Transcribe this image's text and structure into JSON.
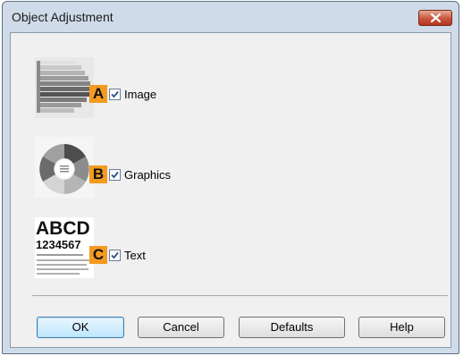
{
  "window": {
    "title": "Object Adjustment"
  },
  "options": [
    {
      "badge": "A",
      "label": "Image",
      "checked": true,
      "thumb_icon": "image-grayscale-bars-icon"
    },
    {
      "badge": "B",
      "label": "Graphics",
      "checked": true,
      "thumb_icon": "graphics-donut-icon"
    },
    {
      "badge": "C",
      "label": "Text",
      "checked": true,
      "thumb_icon": "text-sample-icon",
      "thumb_text": {
        "line1": "ABCD",
        "line2": "1234567"
      }
    }
  ],
  "buttons": {
    "ok": "OK",
    "cancel": "Cancel",
    "defaults": "Defaults",
    "help": "Help"
  },
  "colors": {
    "badge": "#f39a20",
    "dialog_frame": "#cfdbe8",
    "close": "#c9553b"
  }
}
